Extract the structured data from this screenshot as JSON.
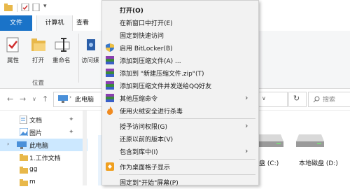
{
  "tabs": {
    "file": "文件",
    "computer": "计算机",
    "view": "查看"
  },
  "ribbon": {
    "properties": "属性",
    "open": "打开",
    "rename": "重命名",
    "access_media": "访问媒",
    "group_location": "位置"
  },
  "address": {
    "path": "此电脑",
    "search_placeholder": "搜索"
  },
  "nav_items": [
    {
      "label": "文档",
      "pinned": true
    },
    {
      "label": "图片",
      "pinned": true
    },
    {
      "label": "此电脑",
      "selected": true
    },
    {
      "label": "1.工作文档"
    },
    {
      "label": "gg"
    },
    {
      "label": "m"
    }
  ],
  "drives": [
    {
      "label": "磁盘 (C:)"
    },
    {
      "label": "本地磁盘 (D:)"
    }
  ],
  "context_menu": {
    "items": [
      {
        "label": "打开(O)",
        "bold": true
      },
      {
        "label": "在新窗口中打开(E)"
      },
      {
        "label": "固定到快速访问"
      },
      {
        "label": "启用 BitLocker(B)"
      },
      {
        "label": "添加到压缩文件(A) ..."
      },
      {
        "label": "添加到 \"新建压缩文件.zip\"(T)"
      },
      {
        "label": "添加到压缩文件并发送给QQ好友"
      },
      {
        "label": "其他压缩命令",
        "submenu": true
      },
      {
        "label": "使用火绒安全进行杀毒"
      },
      {
        "label": "授予访问权限(G)",
        "submenu": true
      },
      {
        "label": "还原以前的版本(V)"
      },
      {
        "label": "包含到库中(I)",
        "submenu": true
      },
      {
        "label": "作为桌面格子显示"
      },
      {
        "label": "固定到\"开始\"屏幕(P)"
      }
    ]
  },
  "colors": {
    "accent": "#1a73c8",
    "selection": "#cce8ff",
    "menu_bg": "#f2f2f2"
  }
}
